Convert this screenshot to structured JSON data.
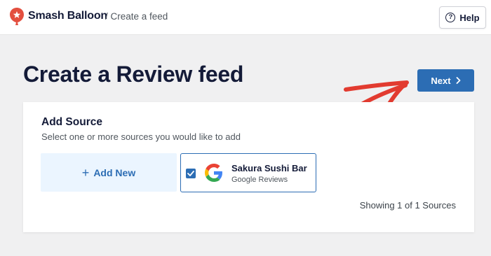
{
  "header": {
    "brand": "Smash Balloon",
    "breadcrumb": "/ Create a feed",
    "help_label": "Help",
    "help_icon": "question-circle-icon",
    "logo_color": "#e34f3f"
  },
  "page": {
    "title": "Create a Review feed",
    "next_label": "Next",
    "next_icon": "chevron-right-icon",
    "accent": "#2c6db4",
    "annotation_color": "#e23b30"
  },
  "source_panel": {
    "title": "Add Source",
    "subtitle": "Select one or more sources you would like to add",
    "add_new_label": "Add New",
    "sources": [
      {
        "name": "Sakura Sushi Bar",
        "type": "Google Reviews",
        "checked": true,
        "icon": "google-icon"
      }
    ],
    "showing_text": "Showing 1 of 1 Sources"
  }
}
